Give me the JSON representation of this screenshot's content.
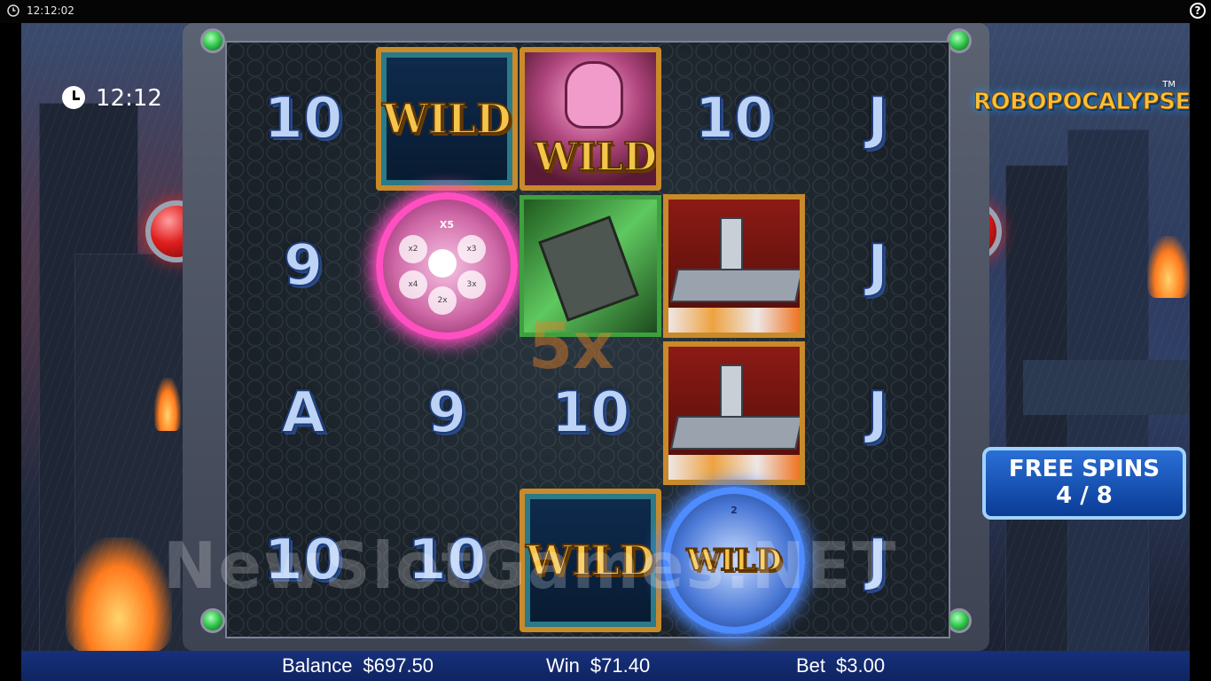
{
  "system_bar": {
    "time": "12:12:02",
    "help": "?"
  },
  "game": {
    "clock": "12:12",
    "logo": "ROBOPOCALYPSE",
    "trademark": "TM",
    "free_spins": {
      "label": "FREE SPINS",
      "count": "4 / 8"
    },
    "multiplier": "5x",
    "watermark": "NewSlotGames.NET",
    "reels": [
      [
        "10",
        "9",
        "A",
        "10"
      ],
      [
        "WILD",
        "X5",
        "9",
        "10"
      ],
      [
        "WILD",
        "",
        "10",
        "WILD"
      ],
      [
        "10",
        "",
        "",
        "WILD"
      ],
      [
        "J",
        "J",
        "J",
        "J"
      ]
    ],
    "revolver_top_label": "X5",
    "revolver_chambers": [
      "x2",
      "x3",
      "x4",
      "2x",
      "3x"
    ],
    "revolver_blue_label": "2"
  },
  "bottom_bar": {
    "balance_label": "Balance",
    "balance_value": "$697.50",
    "win_label": "Win",
    "win_value": "$71.40",
    "bet_label": "Bet",
    "bet_value": "$3.00"
  }
}
